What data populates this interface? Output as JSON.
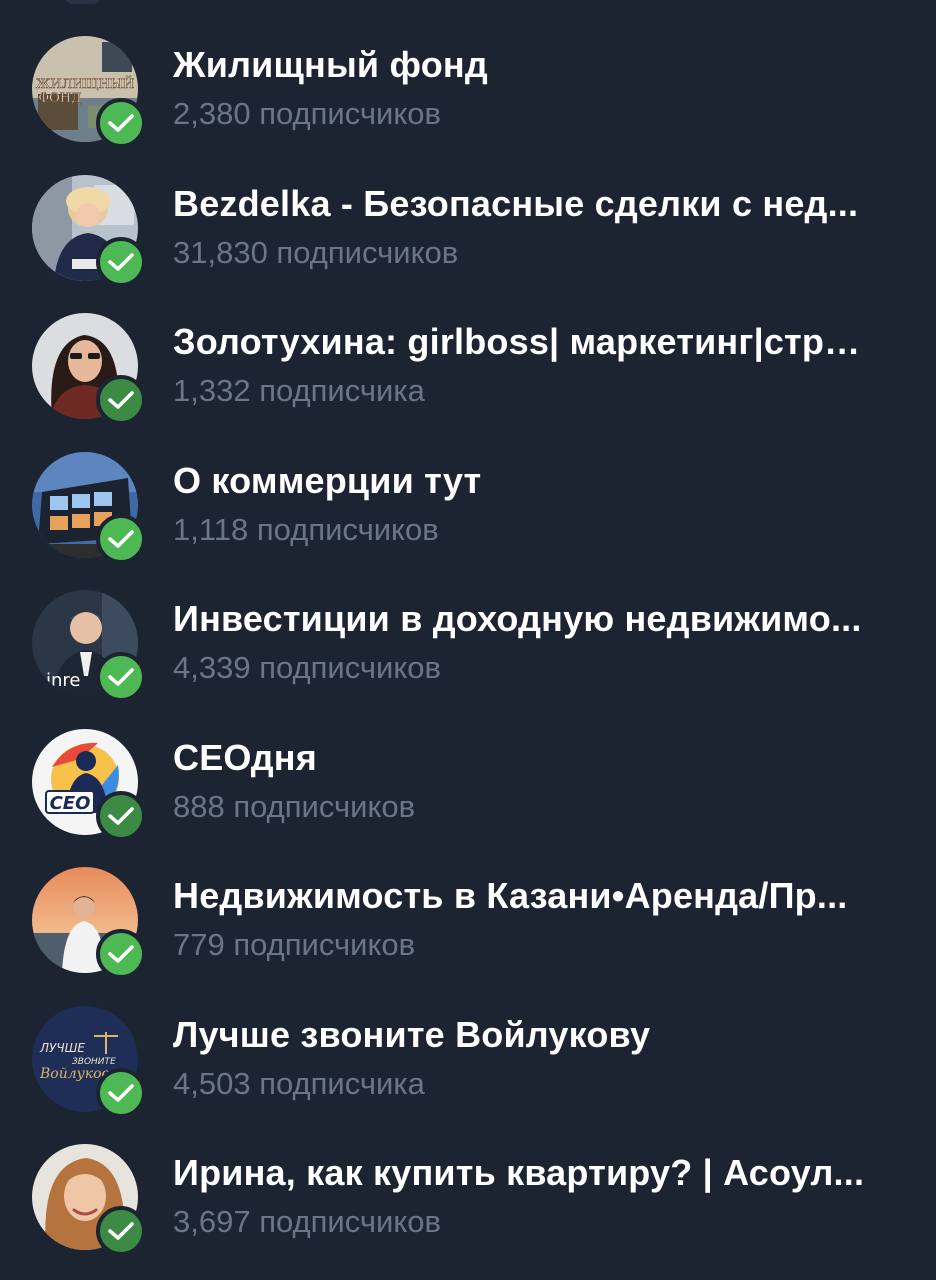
{
  "channels": [
    {
      "title": "Жилищный фонд",
      "subscribers": "2,380 подписчиков",
      "verified": true,
      "avatar_text": "ЖИЛИЩНЫЙ ФОНД",
      "avatar_color": "#8a7b62"
    },
    {
      "title": "Bezdelka - Безопасные сделки с нед...",
      "subscribers": "31,830 подписчиков",
      "verified": true,
      "avatar_color": "#9aa6b4"
    },
    {
      "title": "Золотухина: girlboss| маркетинг|стра...",
      "subscribers": "1,332 подписчика",
      "verified": true,
      "avatar_color": "#d8d9dc"
    },
    {
      "title": "О коммерции тут",
      "subscribers": "1,118 подписчиков",
      "verified": true,
      "avatar_color": "#3a5a8c"
    },
    {
      "title": "Инвестиции в доходную недвижимо...",
      "subscribers": "4,339 подписчиков",
      "verified": true,
      "avatar_text": "inre",
      "avatar_color": "#2a3442"
    },
    {
      "title": "СЕОдня",
      "subscribers": "888 подписчиков",
      "verified": true,
      "avatar_text": "CEO",
      "avatar_color": "#f2f2f2"
    },
    {
      "title": "Недвижимость в Казани•Аренда/Пр...",
      "subscribers": "779 подписчиков",
      "verified": true,
      "avatar_color": "#e3a06a"
    },
    {
      "title": "Лучше звоните Войлукову",
      "subscribers": "4,503 подписчика",
      "verified": true,
      "avatar_text": "ЛУЧШЕ ЗВОНИТЕ Войлукову",
      "avatar_color": "#1e2e56"
    },
    {
      "title": "Ирина, как купить квартиру? | Асоул...",
      "subscribers": "3,697 подписчиков",
      "verified": true,
      "avatar_color": "#cfa57e"
    }
  ],
  "colors": {
    "background": "#1c2431",
    "title": "#ffffff",
    "subtitle": "#6a7585",
    "verified_badge": "#4eb855"
  }
}
